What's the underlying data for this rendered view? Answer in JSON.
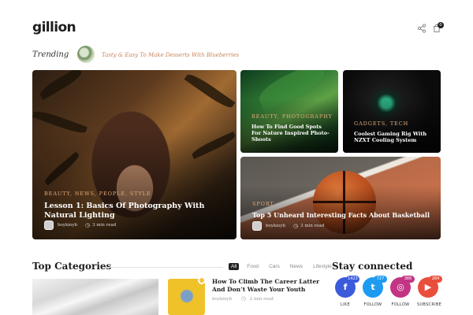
{
  "header": {
    "logo": "gillion",
    "share_icon": "share-icon",
    "cart_icon": "cart-icon",
    "cart_count": "0"
  },
  "trending": {
    "label": "Trending",
    "headline": "Tasty & Easy To Make Desserts With Blueberries"
  },
  "featured": [
    {
      "categories": "BEAUTY, NEWS, PEOPLE, STYLE",
      "title": "Lesson 1: Basics Of Photography With Natural Lighting",
      "author": "boykioyb",
      "read_time": "3 min read"
    },
    {
      "categories": "BEAUTY, PHOTOGRAPHY",
      "title": "How To Find Good Spots For Nature Inspired Photo-Shoots"
    },
    {
      "categories": "GADGETS, TECH",
      "title": "Coolest Gaming Rig With NZXT Cooling System"
    },
    {
      "categories": "SPORT",
      "title": "Top 5 Unheard Interesting Facts About Basketball",
      "author": "boykioyb",
      "read_time": "3 min read"
    }
  ],
  "top_categories": {
    "title": "Top Categories",
    "filters": [
      "All",
      "Food",
      "Cars",
      "News",
      "Lifestyle"
    ],
    "active_filter": "All",
    "post": {
      "title": "How To Climb The Career Latter And Don’t Waste Your Youth",
      "author": "boykioyb",
      "read_time": "2 min read"
    }
  },
  "stay_connected": {
    "title": "Stay connected",
    "networks": [
      {
        "icon": "facebook-icon",
        "glyph": "f",
        "count": "1423",
        "label": "LIKE",
        "color": "#3b5bdb"
      },
      {
        "icon": "twitter-icon",
        "glyph": "t",
        "count": "727",
        "label": "FOLLOW",
        "color": "#1d9bf0"
      },
      {
        "icon": "instagram-icon",
        "glyph": "◎",
        "count": "386",
        "label": "FOLLOW",
        "color": "#c13584"
      },
      {
        "icon": "youtube-icon",
        "glyph": "▶",
        "count": "284",
        "label": "SUBSCRIBE",
        "color": "#e94e3c"
      }
    ]
  }
}
